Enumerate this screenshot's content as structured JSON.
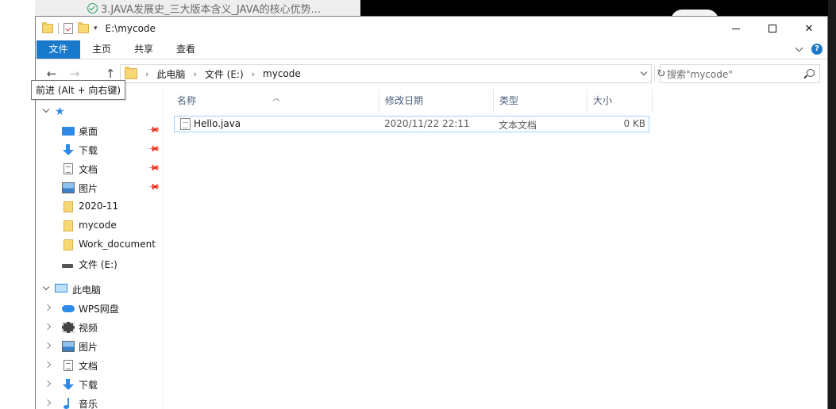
{
  "background": {
    "behind_tab_title": "3.JAVA发展史_三大版本含义_JAVA的核心优势..."
  },
  "window": {
    "title": "E:\\mycode",
    "ribbon_tabs": [
      "文件",
      "主页",
      "共享",
      "查看"
    ],
    "help": "?"
  },
  "nav": {
    "back": "←",
    "forward": "→",
    "up": "↑",
    "breadcrumbs": [
      "此电脑",
      "文件 (E:)",
      "mycode"
    ],
    "refresh": "↻",
    "search_placeholder": "搜索\"mycode\""
  },
  "tooltip": "前进 (Alt + 向右键)",
  "sidebar": {
    "quick_access": [
      {
        "label": "桌面",
        "icon": "desktop-icon",
        "pinned": true
      },
      {
        "label": "下载",
        "icon": "download-icon",
        "pinned": true
      },
      {
        "label": "文档",
        "icon": "document-icon",
        "pinned": true
      },
      {
        "label": "图片",
        "icon": "picture-icon",
        "pinned": true
      },
      {
        "label": "2020-11",
        "icon": "folder-icon",
        "pinned": false
      },
      {
        "label": "mycode",
        "icon": "folder-icon",
        "pinned": false
      },
      {
        "label": "Work_document",
        "icon": "folder-icon",
        "pinned": false
      },
      {
        "label": "文件 (E:)",
        "icon": "drive-icon",
        "pinned": false
      }
    ],
    "this_pc": "此电脑",
    "pc_items": [
      {
        "label": "WPS网盘",
        "icon": "cloud-icon"
      },
      {
        "label": "视频",
        "icon": "video-icon"
      },
      {
        "label": "图片",
        "icon": "picture-icon"
      },
      {
        "label": "文档",
        "icon": "document-icon"
      },
      {
        "label": "下载",
        "icon": "download-icon"
      },
      {
        "label": "音乐",
        "icon": "music-icon"
      }
    ]
  },
  "columns": [
    "名称",
    "修改日期",
    "类型",
    "大小"
  ],
  "files": [
    {
      "name": "Hello.java",
      "modified": "2020/11/22 22:11",
      "type": "文本文档",
      "size": "0 KB"
    }
  ]
}
